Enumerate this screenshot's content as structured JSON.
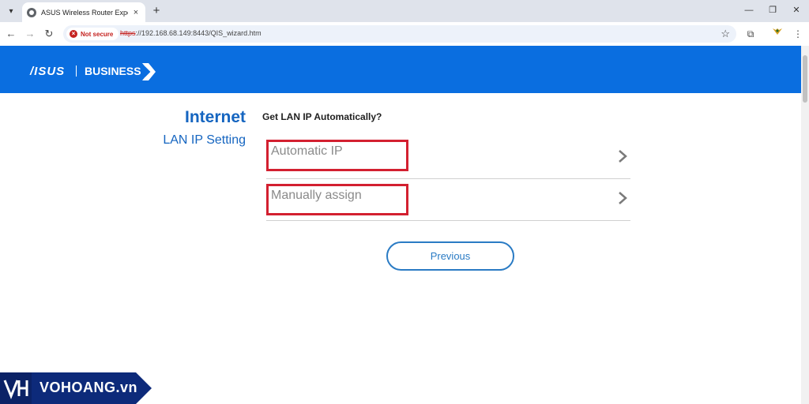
{
  "browser": {
    "tab_title": "ASUS Wireless Router ExpertWiFi",
    "tab_close": "×",
    "new_tab": "+",
    "security_label": "Not secure",
    "url_scheme": "https",
    "url_rest": "://192.168.68.149:8443/QIS_wizard.htm"
  },
  "header": {
    "logo": "/ISUS",
    "business": "BUSINESS",
    "brand_color": "#0a6ee0"
  },
  "wizard": {
    "step_title": "Internet",
    "step_subtitle": "LAN IP Setting",
    "question": "Get LAN IP Automatically?",
    "options": [
      {
        "label": "Automatic IP"
      },
      {
        "label": "Manually assign"
      }
    ],
    "previous_label": "Previous",
    "highlight_color": "#d32030"
  },
  "watermark": {
    "text": "VOHOANG.vn"
  }
}
